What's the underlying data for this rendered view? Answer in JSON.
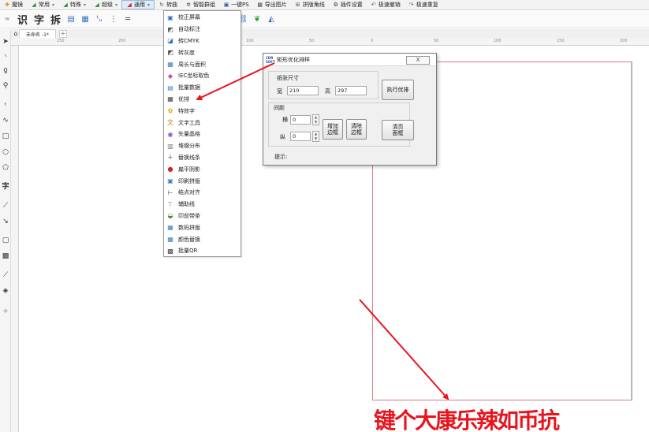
{
  "menubar": {
    "items": [
      {
        "icon": "app-icon",
        "label": "魔镜",
        "drop": false,
        "active": false
      },
      {
        "icon": "tool-icon",
        "label": "常用",
        "drop": true,
        "active": false
      },
      {
        "icon": "tool-icon",
        "label": "特殊",
        "drop": true,
        "active": false
      },
      {
        "icon": "tool-icon",
        "label": "超级",
        "drop": true,
        "active": false
      },
      {
        "icon": "tool-icon",
        "label": "通用",
        "drop": true,
        "active": true
      },
      {
        "icon": "rotate-icon",
        "label": "转曲",
        "drop": false,
        "active": false
      },
      {
        "icon": "group-icon",
        "label": "智能群组",
        "drop": false,
        "active": false
      },
      {
        "icon": "ps-icon",
        "label": "一键PS",
        "drop": false,
        "active": false
      },
      {
        "icon": "image-icon",
        "label": "导出图片",
        "drop": false,
        "active": false
      },
      {
        "icon": "corner-icon",
        "label": "拼版角线",
        "drop": false,
        "active": false
      },
      {
        "icon": "gear-icon",
        "label": "插件设置",
        "drop": false,
        "active": false
      },
      {
        "icon": "undo-icon",
        "label": "极速撤销",
        "drop": false,
        "active": false
      },
      {
        "icon": "redo-icon",
        "label": "极速重复",
        "drop": false,
        "active": false
      }
    ]
  },
  "toolbar": {
    "big_labels": [
      "识",
      "字",
      "拆"
    ]
  },
  "doc_tab": {
    "title": "未命名 -1*"
  },
  "ruler_labels": [
    "250",
    "200",
    "100",
    "50",
    "0",
    "50",
    "100",
    "150",
    "200"
  ],
  "menu": {
    "items": [
      {
        "label": "校正屏幕",
        "color": "#3a6fc4"
      },
      {
        "label": "自动标注",
        "color": "#555555"
      },
      {
        "label": "转CMYK",
        "color": "#2b6cd1"
      },
      {
        "label": "转灰度",
        "color": "#555555"
      },
      {
        "label": "周长与面积",
        "color": "#3b7fc9"
      },
      {
        "label": "IEC坐标取色",
        "color": "#d04a9a"
      },
      {
        "label": "批量数据",
        "color": "#3b7fc9"
      },
      {
        "label": "优排",
        "color": "#444444"
      },
      {
        "label": "特效字",
        "color": "#d9a400"
      },
      {
        "label": "文字工具",
        "color": "#d07a00"
      },
      {
        "label": "矢量晶格",
        "color": "#8a4bd0"
      },
      {
        "label": "堆缀分布",
        "color": "#777777"
      },
      {
        "label": "替换线条",
        "color": "#444444"
      },
      {
        "label": "扁平阴影",
        "color": "#d42020"
      },
      {
        "label": "印刷拼版",
        "color": "#3b7fc9"
      },
      {
        "label": "结点对齐",
        "color": "#444444"
      },
      {
        "label": "辅助线",
        "color": "#777777"
      },
      {
        "label": "印前带茶",
        "color": "#4a8a3a"
      },
      {
        "label": "数码拼版",
        "color": "#3b7fc9"
      },
      {
        "label": "颜色替换",
        "color": "#3b7fc9"
      },
      {
        "label": "批量QR",
        "color": "#444444"
      }
    ]
  },
  "dialog": {
    "logo_text": "CDR\nSOFT",
    "title": "矩形优化排样",
    "close_label": "X",
    "paper_group": "纸张尺寸",
    "width_label": "宽",
    "width_value": "210",
    "height_label": "高",
    "height_value": "297",
    "run_button": "执行优排",
    "spacing_group": "间距",
    "h_label": "横",
    "h_value": "0",
    "v_label": "纵",
    "v_value": "0",
    "add_frame_button": "增加\n边框",
    "clear_frame_button": "清除\n边框",
    "clear_page_button": "清页\n面框",
    "hint_label": "提示:"
  },
  "bottom_text": "键个大康乐辣如币抗"
}
